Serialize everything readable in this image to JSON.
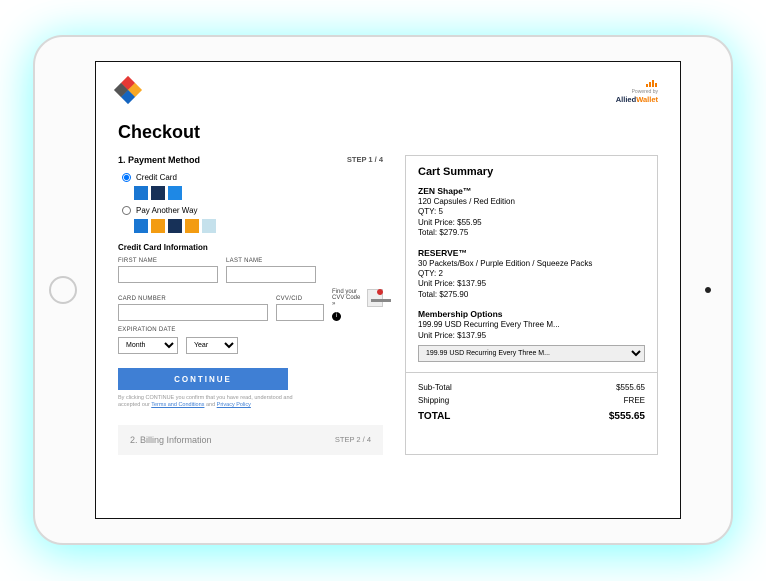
{
  "brand": {
    "powered_by": "Powered by",
    "name_1": "Allied",
    "name_2": "Wallet"
  },
  "title": "Checkout",
  "step1": {
    "heading": "1. Payment Method",
    "step": "STEP 1 / 4"
  },
  "pay_credit": "Credit Card",
  "pay_other": "Pay Another Way",
  "cc_section": "Credit Card Information",
  "labels": {
    "first": "FIRST NAME",
    "last": "LAST NAME",
    "card": "CARD NUMBER",
    "cvv": "CVV/CID",
    "exp": "EXPIRATION DATE",
    "month": "Month",
    "year": "Year"
  },
  "cvv_help": "Find your CVV Code »",
  "continue": "CONTINUE",
  "terms_pre": "By clicking CONTINUE you confirm that you have read, understood and accepted our ",
  "terms_link1": "Terms and Conditions",
  "terms_and": " and ",
  "terms_link2": "Privacy Policy",
  "step2": {
    "heading": "2. Billing Information",
    "step": "STEP 2 / 4"
  },
  "cart": {
    "title": "Cart Summary",
    "items": [
      {
        "name": "ZEN Shape™",
        "desc": "120 Capsules / Red Edition",
        "qty": "QTY: 5",
        "unit": "Unit Price: $55.95",
        "total": "Total: $279.75"
      },
      {
        "name": "RESERVE™",
        "desc": "30 Packets/Box / Purple Edition / Squeeze Packs",
        "qty": "QTY: 2",
        "unit": "Unit Price: $137.95",
        "total": "Total: $275.90"
      }
    ],
    "memb_title": "Membership Options",
    "memb_line": "199.99 USD Recurring Every Three M...",
    "memb_unit": "Unit Price: $137.95",
    "memb_select": "199.99 USD Recurring Every Three M...",
    "subtotal_l": "Sub-Total",
    "subtotal_v": "$555.65",
    "ship_l": "Shipping",
    "ship_v": "FREE",
    "total_l": "TOTAL",
    "total_v": "$555.65"
  }
}
